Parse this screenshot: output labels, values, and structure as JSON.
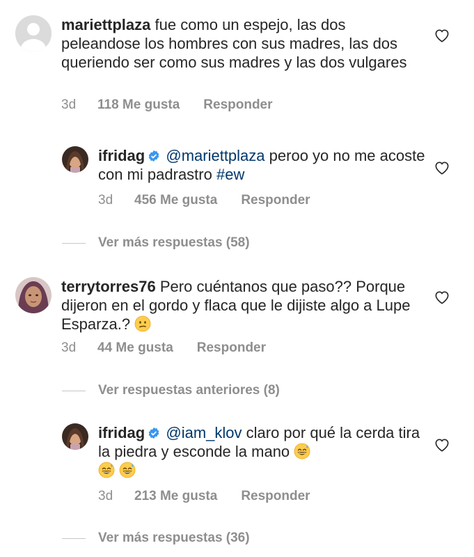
{
  "comments": [
    {
      "username": "mariettplaza",
      "text": "fue como un espejo, las dos peleandose los hombres con sus madres, las dos queriendo ser como sus madres y las dos vulgares",
      "time": "3d",
      "likes": "118 Me gusta",
      "reply_label": "Responder"
    },
    {
      "username": "ifridag",
      "mention": "@mariettplaza",
      "text_before_hashtag": "peroo yo no me acoste con mi padrastro",
      "hashtag": "#ew",
      "time": "3d",
      "likes": "456 Me gusta",
      "reply_label": "Responder"
    },
    {
      "username": "terrytorres76",
      "text": "Pero cuéntanos que paso?? Porque dijeron en el gordo y flaca que le dijiste algo a Lupe Esparza.?",
      "emoji": "confused-face",
      "time": "3d",
      "likes": "44 Me gusta",
      "reply_label": "Responder"
    },
    {
      "username": "ifridag",
      "mention": "@iam_klov",
      "text": "claro por qué la cerda tira la piedra y esconde la mano",
      "emoji": "grinning-sweat-face",
      "time": "3d",
      "likes": "213 Me gusta",
      "reply_label": "Responder"
    }
  ],
  "view_more": {
    "first": "Ver más respuestas (58)",
    "previous": "Ver respuestas anteriores (8)",
    "second": "Ver más respuestas (36)"
  },
  "colors": {
    "text": "#262626",
    "meta": "#8e8e8e",
    "link": "#00376b",
    "verified": "#3897f0"
  }
}
